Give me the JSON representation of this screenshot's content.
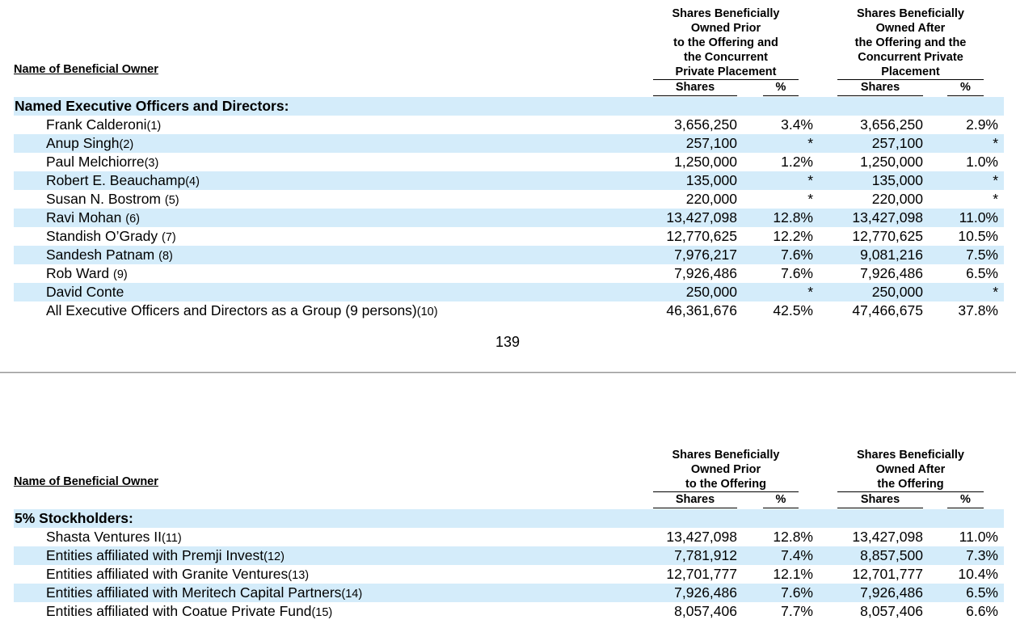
{
  "table1": {
    "owner_header": "Name of Beneficial Owner",
    "prior_header": [
      "Shares Beneficially",
      "Owned Prior",
      "to the Offering and",
      "the Concurrent",
      "Private Placement"
    ],
    "after_header": [
      "Shares Beneficially",
      "Owned After",
      "the Offering and the",
      "Concurrent Private",
      "Placement"
    ],
    "col_shares": "Shares",
    "col_pct": "%",
    "section_label": "Named Executive Officers and Directors:",
    "rows": [
      {
        "name": "Frank Calderoni",
        "fn": "(1)",
        "prior_shares": "3,656,250",
        "prior_pct": "3.4%",
        "after_shares": "3,656,250",
        "after_pct": "2.9%"
      },
      {
        "name": "Anup Singh",
        "fn": "(2)",
        "prior_shares": "257,100",
        "prior_pct": "*",
        "after_shares": "257,100",
        "after_pct": "*"
      },
      {
        "name": "Paul Melchiorre",
        "fn": "(3)",
        "prior_shares": "1,250,000",
        "prior_pct": "1.2%",
        "after_shares": "1,250,000",
        "after_pct": "1.0%"
      },
      {
        "name": "Robert E. Beauchamp",
        "fn": "(4)",
        "prior_shares": "135,000",
        "prior_pct": "*",
        "after_shares": "135,000",
        "after_pct": "*"
      },
      {
        "name": "Susan N. Bostrom ",
        "fn": "(5)",
        "prior_shares": "220,000",
        "prior_pct": "*",
        "after_shares": "220,000",
        "after_pct": "*"
      },
      {
        "name": "Ravi Mohan ",
        "fn": "(6)",
        "prior_shares": "13,427,098",
        "prior_pct": "12.8%",
        "after_shares": "13,427,098",
        "after_pct": "11.0%"
      },
      {
        "name": "Standish O’Grady ",
        "fn": "(7)",
        "prior_shares": "12,770,625",
        "prior_pct": "12.2%",
        "after_shares": "12,770,625",
        "after_pct": "10.5%"
      },
      {
        "name": "Sandesh Patnam ",
        "fn": "(8)",
        "prior_shares": "7,976,217",
        "prior_pct": "7.6%",
        "after_shares": "9,081,216",
        "after_pct": "7.5%"
      },
      {
        "name": "Rob Ward ",
        "fn": "(9)",
        "prior_shares": "7,926,486",
        "prior_pct": "7.6%",
        "after_shares": "7,926,486",
        "after_pct": "6.5%"
      },
      {
        "name": "David Conte",
        "fn": "",
        "prior_shares": "250,000",
        "prior_pct": "*",
        "after_shares": "250,000",
        "after_pct": "*"
      },
      {
        "name": "All Executive Officers and Directors as a Group (9 persons)",
        "fn": "(10)",
        "prior_shares": "46,361,676",
        "prior_pct": "42.5%",
        "after_shares": "47,466,675",
        "after_pct": "37.8%"
      }
    ]
  },
  "page_number": "139",
  "table2": {
    "owner_header": "Name of Beneficial Owner",
    "prior_header": [
      "Shares Beneficially",
      "Owned Prior",
      "to the Offering"
    ],
    "after_header": [
      "Shares Beneficially",
      "Owned After",
      "the Offering"
    ],
    "col_shares": "Shares",
    "col_pct": "%",
    "section_label": "5% Stockholders:",
    "rows": [
      {
        "name": "Shasta Ventures II",
        "fn": "(11)",
        "prior_shares": "13,427,098",
        "prior_pct": "12.8%",
        "after_shares": "13,427,098",
        "after_pct": "11.0%"
      },
      {
        "name": "Entities affiliated with Premji Invest",
        "fn": "(12)",
        "prior_shares": "7,781,912",
        "prior_pct": "7.4%",
        "after_shares": "8,857,500",
        "after_pct": "7.3%"
      },
      {
        "name": "Entities affiliated with Granite Ventures",
        "fn": "(13)",
        "prior_shares": "12,701,777",
        "prior_pct": "12.1%",
        "after_shares": "12,701,777",
        "after_pct": "10.4%"
      },
      {
        "name": "Entities affiliated with Meritech Capital Partners",
        "fn": "(14)",
        "prior_shares": "7,926,486",
        "prior_pct": "7.6%",
        "after_shares": "7,926,486",
        "after_pct": "6.5%"
      },
      {
        "name": "Entities affiliated with Coatue Private Fund",
        "fn": "(15)",
        "prior_shares": "8,057,406",
        "prior_pct": "7.7%",
        "after_shares": "8,057,406",
        "after_pct": "6.6%"
      }
    ]
  }
}
